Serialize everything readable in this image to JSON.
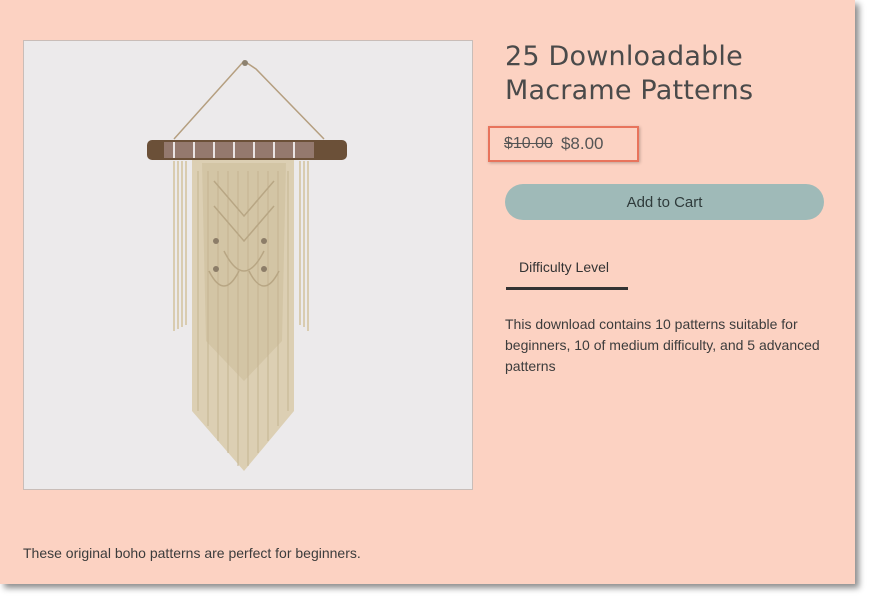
{
  "product": {
    "title": "25 Downloadable Macrame Patterns",
    "image_alt": "macrame-wall-hanging",
    "price_original": "$10.00",
    "price_sale": "$8.00",
    "add_to_cart_label": "Add to Cart",
    "tab_label": "Difficulty Level",
    "description": "This download contains 10 patterns suitable for beginners, 10 of medium difficulty, and 5 advanced patterns",
    "footer_text": "These original boho patterns are perfect for beginners."
  },
  "colors": {
    "page_background": "#fcd2c2",
    "button_background": "#9fbab8",
    "highlight_border": "#e8745c",
    "tab_underline": "#333333"
  }
}
